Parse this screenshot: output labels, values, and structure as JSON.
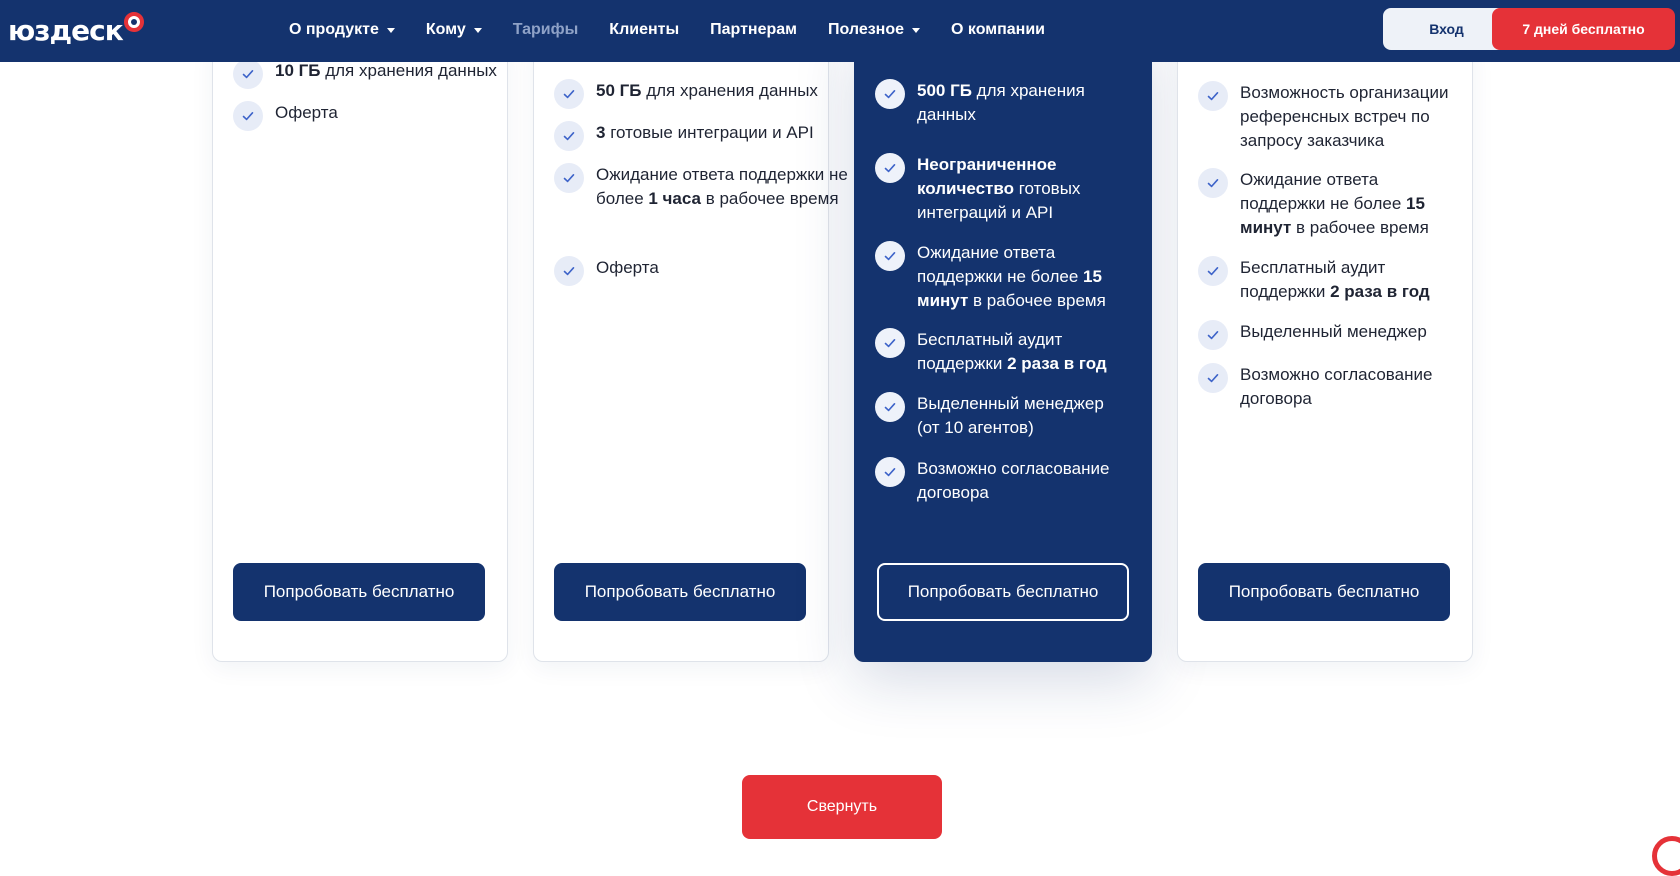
{
  "header": {
    "logo": "юздеск",
    "nav": [
      {
        "label": "О продукте",
        "dropdown": true,
        "active": false
      },
      {
        "label": "Кому",
        "dropdown": true,
        "active": false
      },
      {
        "label": "Тарифы",
        "dropdown": false,
        "active": true
      },
      {
        "label": "Клиенты",
        "dropdown": false,
        "active": false
      },
      {
        "label": "Партнерам",
        "dropdown": false,
        "active": false
      },
      {
        "label": "Полезное",
        "dropdown": true,
        "active": false
      },
      {
        "label": "О компании",
        "dropdown": false,
        "active": false
      }
    ],
    "login_label": "Вход",
    "trial_label": "7 дней бесплатно"
  },
  "plans": [
    {
      "features": [
        {
          "parts": [
            {
              "t": "10 ГБ",
              "b": true
            },
            {
              "t": " для хранения данных",
              "b": false
            }
          ]
        },
        {
          "parts": [
            {
              "t": "Оферта",
              "b": false
            }
          ]
        }
      ],
      "button": "Попробовать бесплатно"
    },
    {
      "features": [
        {
          "parts": [
            {
              "t": "50 ГБ",
              "b": true
            },
            {
              "t": " для хранения данных",
              "b": false
            }
          ]
        },
        {
          "parts": [
            {
              "t": "3",
              "b": true
            },
            {
              "t": " готовые интеграции и API",
              "b": false
            }
          ]
        },
        {
          "parts": [
            {
              "t": "Ожидание ответа поддержки не более ",
              "b": false
            },
            {
              "t": "1 часа",
              "b": true
            },
            {
              "t": " в рабочее время",
              "b": false
            }
          ]
        },
        {
          "parts": [
            {
              "t": "Оферта",
              "b": false
            }
          ]
        }
      ],
      "button": "Попробовать бесплатно"
    },
    {
      "features": [
        {
          "parts": [
            {
              "t": "500 ГБ",
              "b": true
            },
            {
              "t": " для хранения данных",
              "b": false
            }
          ]
        },
        {
          "parts": [
            {
              "t": "Неограниченное количество",
              "b": true
            },
            {
              "t": " готовых интеграций и API",
              "b": false
            }
          ]
        },
        {
          "parts": [
            {
              "t": "Ожидание ответа поддержки не более ",
              "b": false
            },
            {
              "t": "15 минут",
              "b": true
            },
            {
              "t": " в рабочее время",
              "b": false
            }
          ]
        },
        {
          "parts": [
            {
              "t": "Бесплатный аудит поддержки ",
              "b": false
            },
            {
              "t": "2 раза в год",
              "b": true
            }
          ]
        },
        {
          "parts": [
            {
              "t": "Выделенный менеджер (от 10 агентов)",
              "b": false
            }
          ]
        },
        {
          "parts": [
            {
              "t": "Возможно согласование договора",
              "b": false
            }
          ]
        }
      ],
      "button": "Попробовать бесплатно"
    },
    {
      "features": [
        {
          "parts": [
            {
              "t": "Возможность организации референсных встреч по запросу заказчика",
              "b": false
            }
          ]
        },
        {
          "parts": [
            {
              "t": "Ожидание ответа поддержки не более ",
              "b": false
            },
            {
              "t": "15 минут",
              "b": true
            },
            {
              "t": " в рабочее время",
              "b": false
            }
          ]
        },
        {
          "parts": [
            {
              "t": "Бесплатный аудит поддержки ",
              "b": false
            },
            {
              "t": "2 раза в год",
              "b": true
            }
          ]
        },
        {
          "parts": [
            {
              "t": "Выделенный менеджер",
              "b": false
            }
          ]
        },
        {
          "parts": [
            {
              "t": "Возможно согласование договора",
              "b": false
            }
          ]
        }
      ],
      "button": "Попробовать бесплатно"
    }
  ],
  "collapse_label": "Свернуть",
  "colors": {
    "brand": "#14336e",
    "accent": "#e53238"
  }
}
